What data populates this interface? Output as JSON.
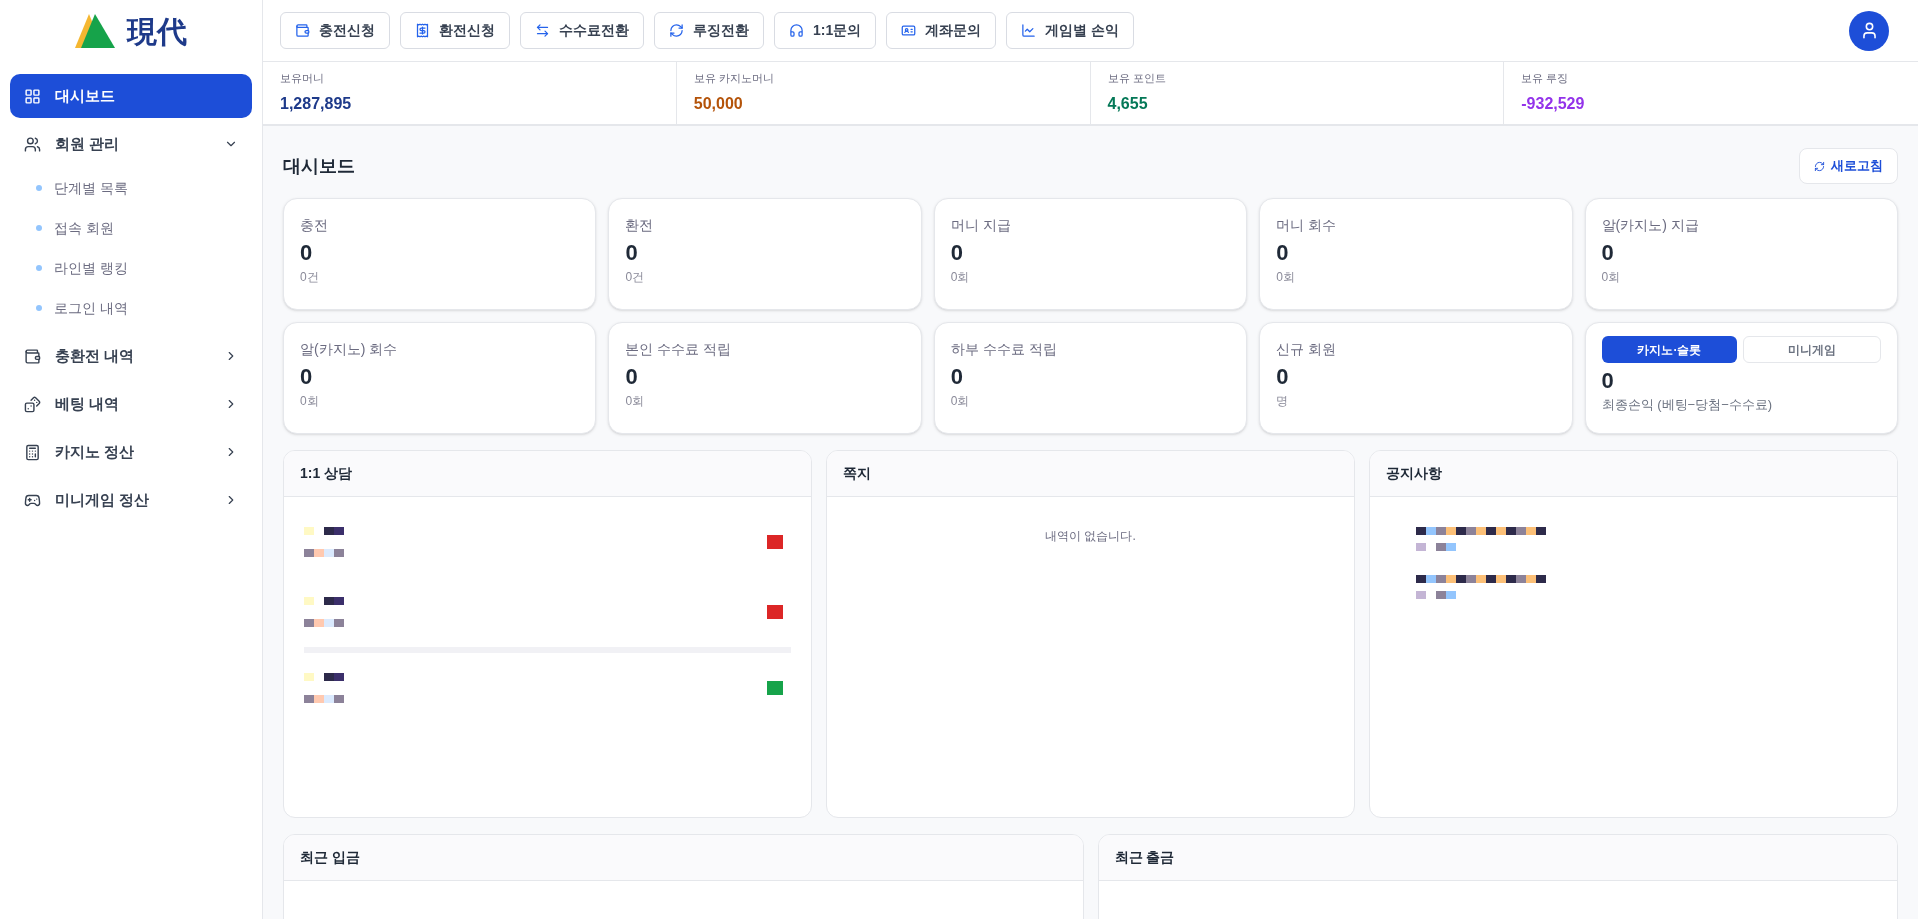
{
  "logo": {
    "text": "現代"
  },
  "header_buttons": [
    {
      "kind": "wallet",
      "label": "충전신청"
    },
    {
      "kind": "receipt",
      "label": "환전신청"
    },
    {
      "kind": "swap",
      "label": "수수료전환"
    },
    {
      "kind": "refresh",
      "label": "루징전환"
    },
    {
      "kind": "headset",
      "label": "1:1문의"
    },
    {
      "kind": "card",
      "label": "계좌문의"
    },
    {
      "kind": "chart",
      "label": "게임별 손익"
    }
  ],
  "balances": [
    {
      "label": "보유머니",
      "value": "1,287,895",
      "color": "#1e3a8a"
    },
    {
      "label": "보유 카지노머니",
      "value": "50,000",
      "color": "#b45309"
    },
    {
      "label": "보유 포인트",
      "value": "4,655",
      "color": "#047857"
    },
    {
      "label": "보유 루징",
      "value": "-932,529",
      "color": "#9333ea"
    }
  ],
  "sidebar": {
    "items": [
      {
        "kind": "grid",
        "label": "대시보드",
        "selected": true
      },
      {
        "kind": "users",
        "label": "회원 관리",
        "selected": false,
        "expanded": true,
        "children": [
          {
            "label": "단계별 목록"
          },
          {
            "label": "접속 회원"
          },
          {
            "label": "라인별 랭킹"
          },
          {
            "label": "로그인 내역"
          }
        ]
      },
      {
        "kind": "wallet",
        "label": "충환전 내역",
        "selected": false,
        "expanded": false
      },
      {
        "kind": "dice",
        "label": "베팅 내역",
        "selected": false,
        "expanded": false
      },
      {
        "kind": "calculator",
        "label": "카지노 정산",
        "selected": false,
        "expanded": false
      },
      {
        "kind": "gamepad",
        "label": "미니게임 정산",
        "selected": false,
        "expanded": false
      }
    ]
  },
  "page": {
    "title": "대시보드",
    "refresh_button": "새로고침"
  },
  "cards": [
    {
      "kind": "stat",
      "label": "충전",
      "value": "0",
      "sub": "0건"
    },
    {
      "kind": "stat",
      "label": "환전",
      "value": "0",
      "sub": "0건"
    },
    {
      "kind": "stat",
      "label": "머니 지급",
      "value": "0",
      "sub": "0회"
    },
    {
      "kind": "stat",
      "label": "머니 회수",
      "value": "0",
      "sub": "0회"
    },
    {
      "kind": "stat",
      "label": "알(카지노) 지급",
      "value": "0",
      "sub": "0회"
    },
    {
      "kind": "stat",
      "label": "알(카지노) 회수",
      "value": "0",
      "sub": "0회"
    },
    {
      "kind": "stat",
      "label": "본인 수수료 적립",
      "value": "0",
      "sub": "0회"
    },
    {
      "kind": "stat",
      "label": "하부 수수료 적립",
      "value": "0",
      "sub": "0회"
    },
    {
      "kind": "stat",
      "label": "신규 회원",
      "value": "0",
      "sub": "명"
    },
    {
      "kind": "profit",
      "tabs": [
        {
          "label": "카지노·슬롯",
          "selected": true
        },
        {
          "label": "미니게임",
          "selected": false
        }
      ],
      "value": "0",
      "sub": "최종손익 (베팅−당첨−수수료)"
    }
  ],
  "panels": [
    {
      "kind": "consult",
      "title": "1:1 상담",
      "entries": [
        {
          "color": "#dc2626"
        },
        {
          "color": "#dc2626"
        },
        {
          "color": "#16a34a"
        }
      ]
    },
    {
      "kind": "empty",
      "title": "쪽지",
      "message": "내역이 없습니다."
    },
    {
      "kind": "notice",
      "title": "공지사항"
    }
  ],
  "bottom_panels": [
    {
      "title": "최근 입금"
    },
    {
      "title": "최근 출금"
    }
  ]
}
